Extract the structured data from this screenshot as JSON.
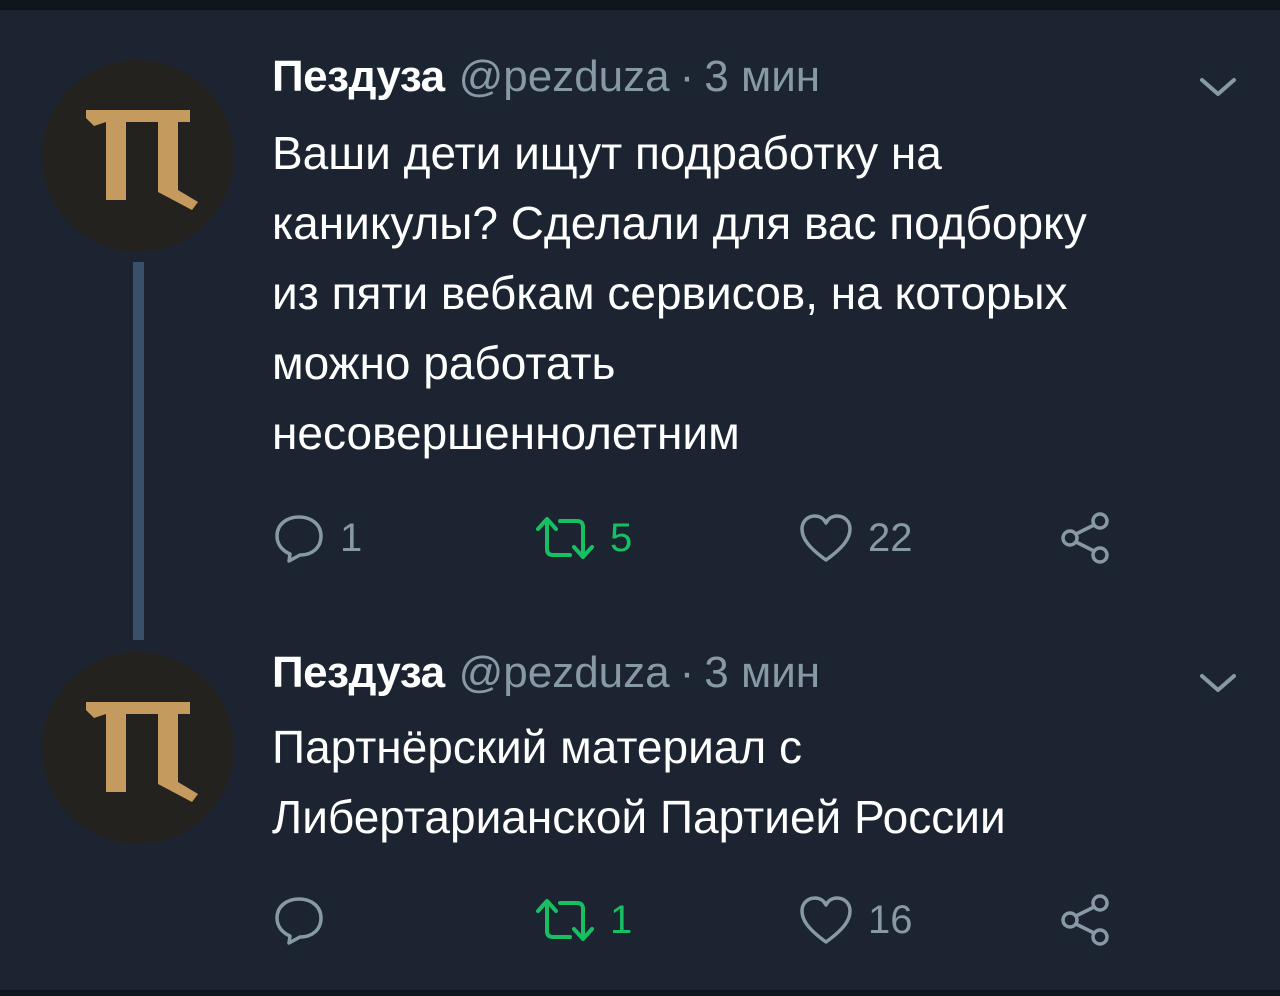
{
  "tweets": [
    {
      "author_name": "Пездуза",
      "author_handle": "@pezduza",
      "separator": "·",
      "timestamp": "3 мин",
      "text": "Ваши дети ищут подработку на\nканикулы? Сделали для вас подборку\nиз пяти вебкам сервисов, на которых\nможно работать\nнесовершеннолетним",
      "reply_count": "1",
      "retweet_count": "5",
      "like_count": "22",
      "retweeted": true
    },
    {
      "author_name": "Пездуза",
      "author_handle": "@pezduza",
      "separator": "·",
      "timestamp": "3 мин",
      "text": "Партнёрский материал с\nЛибертарианской Партией России",
      "reply_count": "",
      "retweet_count": "1",
      "like_count": "16",
      "retweeted": true
    }
  ],
  "icons": {
    "avatar": "pezduza-logo-icon",
    "menu": "chevron-down-icon",
    "reply": "reply-bubble-icon",
    "retweet": "retweet-icon",
    "like": "heart-icon",
    "share": "share-icon"
  },
  "colors": {
    "background": "#1b2430",
    "text": "#ffffff",
    "secondary": "#8899a6",
    "retweet_active": "#17bf63",
    "thread_line": "#3a5068",
    "avatar_bg": "#23221f",
    "logo": "#c49a5f"
  }
}
